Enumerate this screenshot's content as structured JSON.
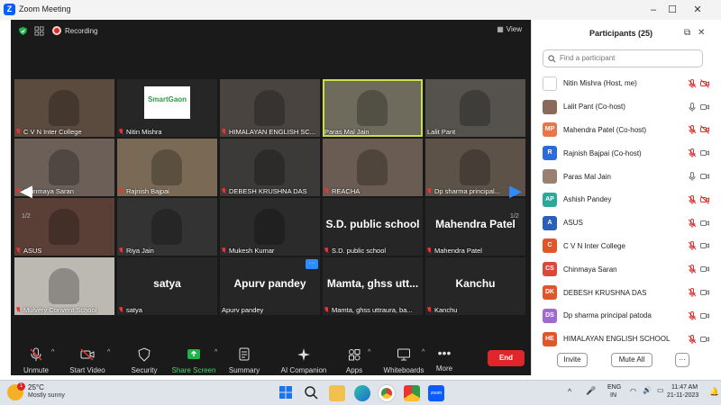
{
  "window": {
    "title": "Zoom Meeting"
  },
  "topbar": {
    "recording": "Recording",
    "view": "View"
  },
  "grid": {
    "page_left": "1/2",
    "page_right": "1/2",
    "tiles": [
      {
        "name": "C V N Inter College",
        "muted": true,
        "kind": "video",
        "bg": "#5b4a3e"
      },
      {
        "name": "Nitin Mishra",
        "muted": true,
        "kind": "logo",
        "bg": "#262626"
      },
      {
        "name": "HIMALAYAN ENGLISH SC...",
        "muted": true,
        "kind": "video",
        "bg": "#4a4440"
      },
      {
        "name": "Paras Mal Jain",
        "muted": false,
        "kind": "video",
        "bg": "#6e6a5c"
      },
      {
        "name": "Lalit Pant",
        "muted": false,
        "kind": "video",
        "bg": "#55524d"
      },
      {
        "name": "Chinmaya Saran",
        "muted": true,
        "kind": "video",
        "bg": "#6b5f58"
      },
      {
        "name": "Rajnish Bajpai",
        "muted": true,
        "kind": "video",
        "bg": "#7a6a55"
      },
      {
        "name": "DEBESH KRUSHNA DAS",
        "muted": true,
        "kind": "video",
        "bg": "#3c3a38"
      },
      {
        "name": "REACHA",
        "muted": true,
        "kind": "video",
        "bg": "#6a5c52"
      },
      {
        "name": "Dp sharma principal...",
        "muted": true,
        "kind": "video",
        "bg": "#5c5248"
      },
      {
        "name": "ASUS",
        "muted": true,
        "kind": "video",
        "bg": "#5a3f36"
      },
      {
        "name": "Riya Jain",
        "muted": true,
        "kind": "video",
        "bg": "#333"
      },
      {
        "name": "Mukesh Kumar",
        "muted": true,
        "kind": "video",
        "bg": "#2b2b2b"
      },
      {
        "name": "S.D. public school",
        "muted": true,
        "kind": "text",
        "big": "S.D. public school",
        "bg": "#262626"
      },
      {
        "name": "Mahendra Patel",
        "muted": true,
        "kind": "text",
        "big": "Mahendra Patel",
        "bg": "#262626"
      },
      {
        "name": "Mulvery Convent School",
        "muted": true,
        "kind": "video",
        "bg": "#bcb8b2"
      },
      {
        "name": "satya",
        "muted": true,
        "kind": "text",
        "big": "satya",
        "bg": "#262626"
      },
      {
        "name": "Apurv pandey",
        "muted": false,
        "kind": "text",
        "big": "Apurv pandey",
        "bg": "#262626"
      },
      {
        "name": "Mamta, ghss uttraura, ba...",
        "muted": true,
        "kind": "text",
        "big": "Mamta, ghss utt...",
        "bg": "#262626"
      },
      {
        "name": "Kanchu",
        "muted": true,
        "kind": "text",
        "big": "Kanchu",
        "bg": "#262626"
      }
    ],
    "logo_text": "SmartGaon"
  },
  "toolbar": {
    "unmute": "Unmute",
    "start_video": "Start Video",
    "security": "Security",
    "share_screen": "Share Screen",
    "summary": "Summary",
    "ai_companion": "AI Companion",
    "apps": "Apps",
    "whiteboards": "Whiteboards",
    "more": "More",
    "end": "End"
  },
  "participants": {
    "title": "Participants (25)",
    "search_placeholder": "Find a participant",
    "list": [
      {
        "name": "Nitin Mishra (Host, me)",
        "initials": "",
        "color": "#ffffff",
        "mic": "muted",
        "cam": "off"
      },
      {
        "name": "Lalit Pant (Co-host)",
        "initials": "",
        "color": "#8a6a5a",
        "mic": "on",
        "cam": "on"
      },
      {
        "name": "Mahendra Patel (Co-host)",
        "initials": "MP",
        "color": "#e8764a",
        "mic": "muted",
        "cam": "off"
      },
      {
        "name": "Rajnish Bajpai (Co-host)",
        "initials": "R",
        "color": "#2f6bd8",
        "mic": "muted",
        "cam": "on"
      },
      {
        "name": "Paras Mal Jain",
        "initials": "",
        "color": "#9a8070",
        "mic": "on",
        "cam": "on"
      },
      {
        "name": "Ashish Pandey",
        "initials": "AP",
        "color": "#2ca89a",
        "mic": "muted",
        "cam": "off"
      },
      {
        "name": "ASUS",
        "initials": "A",
        "color": "#2b5fb8",
        "mic": "muted",
        "cam": "on"
      },
      {
        "name": "C V N Inter College",
        "initials": "C",
        "color": "#e0562a",
        "mic": "muted",
        "cam": "on"
      },
      {
        "name": "Chinmaya Saran",
        "initials": "CS",
        "color": "#d64a3a",
        "mic": "muted",
        "cam": "on"
      },
      {
        "name": "DEBESH KRUSHNA DAS",
        "initials": "DK",
        "color": "#e0562a",
        "mic": "muted",
        "cam": "on"
      },
      {
        "name": "Dp sharma principal patoda",
        "initials": "DS",
        "color": "#a06ad0",
        "mic": "muted",
        "cam": "on"
      },
      {
        "name": "HIMALAYAN ENGLISH SCHOOL",
        "initials": "HE",
        "color": "#e0562a",
        "mic": "muted",
        "cam": "on"
      }
    ],
    "invite": "Invite",
    "mute_all": "Mute All",
    "more": "···"
  },
  "taskbar": {
    "temp": "25°C",
    "weather": "Mostly sunny",
    "badge": "1",
    "lang1": "ENG",
    "lang2": "IN",
    "time": "11:47 AM",
    "date": "21-11-2023"
  }
}
